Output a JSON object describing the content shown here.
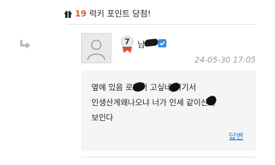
{
  "lucky_point": {
    "count": "19",
    "label": "럭키 포인트 당첨!"
  },
  "comment": {
    "author": "남",
    "level": "7",
    "timestamp": "24-05-30 17:05",
    "body": "옆에 있음 로찔러 고싶네 여기서\n인생산게왜나오냐 너가 인세 같이산게\n보인다",
    "reply_label": "답변"
  },
  "colors": {
    "accent_orange": "#e8592b",
    "link_blue": "#2b7cd3",
    "verified_blue": "#3a8ee6",
    "timestamp_gray": "#9a9a9a"
  },
  "icons": [
    "gift-icon",
    "reply-arrow-icon",
    "default-avatar-icon",
    "level-badge-icon",
    "verified-icon"
  ]
}
